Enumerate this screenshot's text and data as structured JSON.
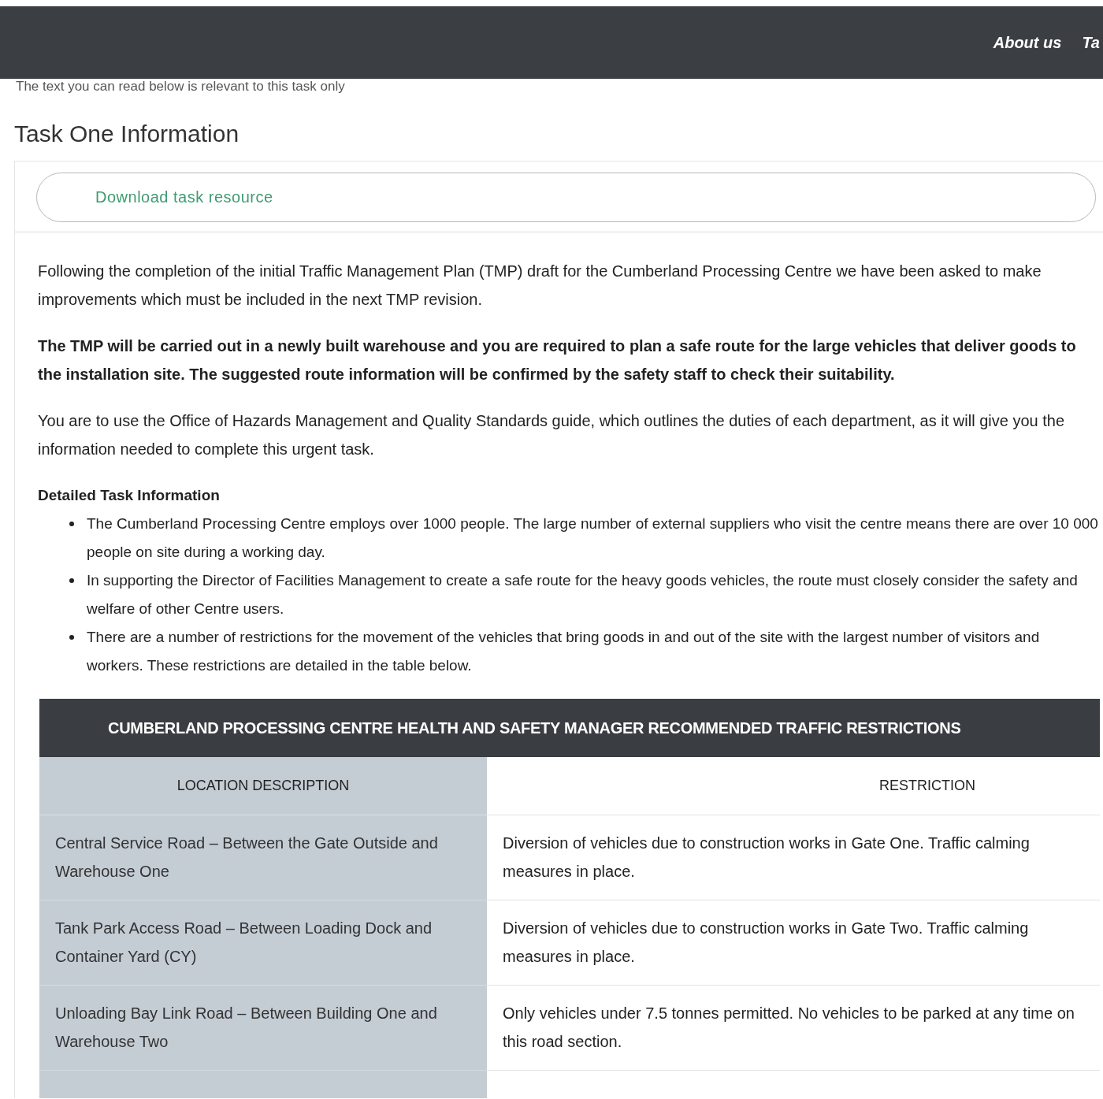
{
  "nav": {
    "links": [
      "About us",
      "Ta"
    ]
  },
  "intro_line": "The text you can read below is relevant to this task only",
  "section_title": "Task One Information",
  "card": {
    "download_button": "Download task resource",
    "paragraphs": [
      {
        "text": "Following the completion of the initial Traffic Management Plan (TMP) draft for the Cumberland Processing Centre we have been asked to make improvements which must be included in the next TMP revision.",
        "bold": false
      },
      {
        "text": "The TMP will be carried out in a newly built warehouse and you are required to plan a safe route for the large vehicles that deliver goods to the installation site. The suggested route information will be confirmed by the safety staff to check their suitability.",
        "bold": true
      },
      {
        "text": "You are to use the Office of Hazards Management and Quality Standards guide, which outlines the duties of each department, as it will give you the information needed to complete this urgent task.",
        "bold": false
      }
    ],
    "details": {
      "heading": "Detailed Task Information",
      "items": [
        "The Cumberland Processing Centre employs over 1000 people. The large number of external suppliers who visit the centre means there are over 10 000 people on site during a working day.",
        "In supporting the Director of Facilities Management to create a safe route for the heavy goods vehicles, the route must closely consider the safety and welfare of other Centre users.",
        "There are a number of restrictions for the movement of the vehicles that bring goods in and out of the site with the largest number of visitors and workers. These restrictions are detailed in the table below."
      ]
    },
    "table": {
      "title": "CUMBERLAND PROCESSING CENTRE HEALTH AND SAFETY MANAGER RECOMMENDED TRAFFIC RESTRICTIONS",
      "columns": [
        "LOCATION DESCRIPTION",
        "RESTRICTION"
      ],
      "rows": [
        [
          "Central Service Road – Between the Gate Outside and Warehouse One",
          "Diversion of vehicles due to construction works in Gate One. Traffic calming measures in place."
        ],
        [
          "Tank Park Access Road – Between Loading Dock and Container Yard (CY)",
          "Diversion of vehicles due to construction works in Gate Two. Traffic calming measures in place."
        ],
        [
          "Unloading Bay Link Road – Between Building One and Warehouse Two",
          "Only vehicles under 7.5 tonnes permitted. No vehicles to be parked at any time on this road section."
        ]
      ]
    }
  }
}
